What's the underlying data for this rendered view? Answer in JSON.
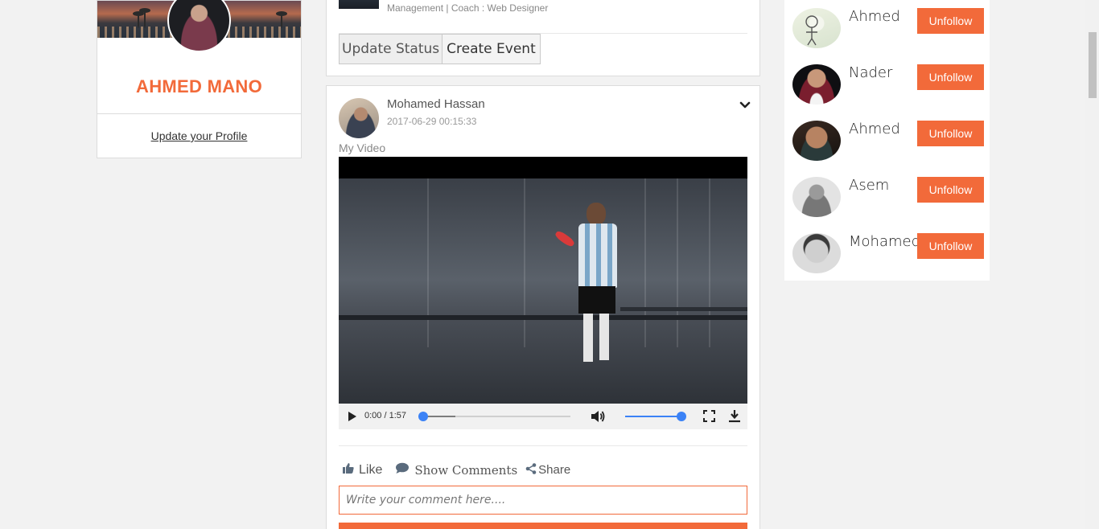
{
  "profile": {
    "name": "AHMED MANO",
    "update_link": "Update your Profile"
  },
  "composer": {
    "meta": "Management | Coach : Web Designer",
    "update_status": "Update Status",
    "create_event": "Create Event"
  },
  "post": {
    "author": "Mohamed Hassan",
    "timestamp": "2017-06-29 00:15:33",
    "caption": "My Video",
    "video": {
      "time": "0:00 / 1:57",
      "progress": 0,
      "buffered": 0.22,
      "volume": 1.0
    },
    "actions": {
      "like": "Like",
      "comments": "Show Comments",
      "share": "Share"
    },
    "comment_placeholder": "Write your comment here...."
  },
  "following": [
    {
      "name": "Ahmed",
      "button": "Unfollow"
    },
    {
      "name": "Nader",
      "button": "Unfollow"
    },
    {
      "name": "Ahmed",
      "button": "Unfollow"
    },
    {
      "name": "Asem",
      "button": "Unfollow"
    },
    {
      "name": "Mohamed",
      "button": "Unfollow"
    }
  ],
  "colors": {
    "accent": "#f26a3a",
    "video_control_blue": "#3b82f6"
  },
  "icons": {
    "post_menu": "chevron-down-icon",
    "play": "play-icon",
    "volume": "volume-icon",
    "fullscreen": "fullscreen-icon",
    "download": "download-icon",
    "like": "thumbs-up-icon",
    "comments": "comment-icon",
    "share": "share-icon"
  }
}
